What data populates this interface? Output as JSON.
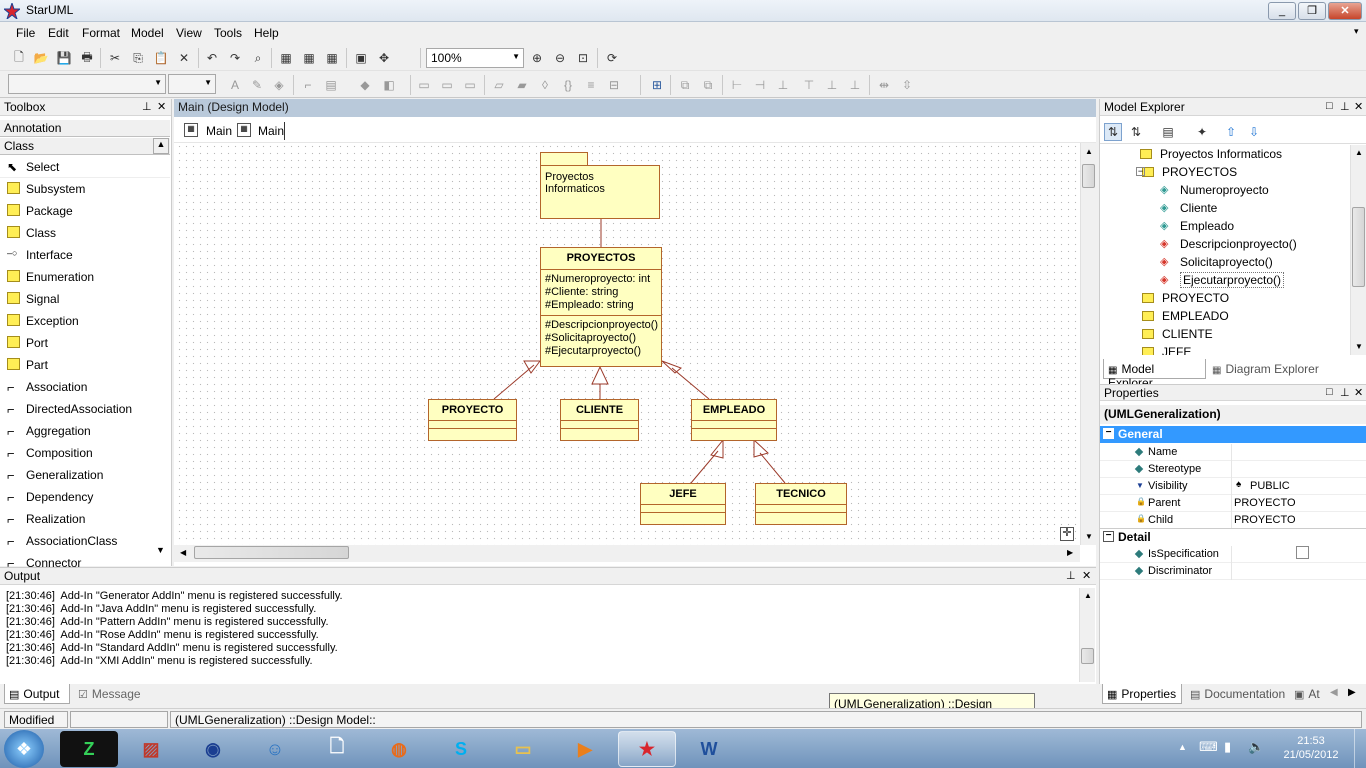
{
  "window": {
    "title": "StarUML",
    "min": "_",
    "max": "❐",
    "close": "✕"
  },
  "menu": [
    "File",
    "Edit",
    "Format",
    "Model",
    "View",
    "Tools",
    "Help"
  ],
  "toolbar": {
    "zoom": "100%"
  },
  "toolbox": {
    "title": "Toolbox",
    "annotation": "Annotation",
    "class_header": "Class",
    "items": [
      "Select",
      "Subsystem",
      "Package",
      "Class",
      "Interface",
      "Enumeration",
      "Signal",
      "Exception",
      "Port",
      "Part",
      "Association",
      "DirectedAssociation",
      "Aggregation",
      "Composition",
      "Generalization",
      "Dependency",
      "Realization",
      "AssociationClass",
      "Connector"
    ]
  },
  "diagram": {
    "title": "Main (Design Model)",
    "tabs": [
      "Main",
      "Main"
    ],
    "package_name": "Proyectos Informaticos",
    "main_class": {
      "name": "PROYECTOS",
      "attributes": [
        "#Numeroproyecto: int",
        "#Cliente: string",
        "#Empleado: string"
      ],
      "operations": [
        "#Descripcionproyecto()",
        "#Solicitaproyecto()",
        "#Ejecutarproyecto()"
      ]
    },
    "sub_classes": [
      "PROYECTO",
      "CLIENTE",
      "EMPLEADO"
    ],
    "leaf_classes": [
      "JEFE",
      "TECNICO"
    ]
  },
  "explorer": {
    "title": "Model Explorer",
    "items": [
      {
        "label": "Proyectos Informaticos",
        "type": "package"
      },
      {
        "label": "PROYECTOS",
        "type": "class"
      },
      {
        "label": "Numeroproyecto",
        "type": "attribute"
      },
      {
        "label": "Cliente",
        "type": "attribute"
      },
      {
        "label": "Empleado",
        "type": "attribute"
      },
      {
        "label": "Descripcionproyecto()",
        "type": "operation"
      },
      {
        "label": "Solicitaproyecto()",
        "type": "operation"
      },
      {
        "label": "Ejecutarproyecto()",
        "type": "operation"
      },
      {
        "label": "PROYECTO",
        "type": "class"
      },
      {
        "label": "EMPLEADO",
        "type": "class"
      },
      {
        "label": "CLIENTE",
        "type": "class"
      },
      {
        "label": "JEFE",
        "type": "class"
      }
    ],
    "tabs": [
      "Model Explorer",
      "Diagram Explorer"
    ]
  },
  "properties": {
    "title": "Properties",
    "selection": "(UMLGeneralization)",
    "group_general": "General",
    "group_detail": "Detail",
    "rows": [
      {
        "name": "Name",
        "value": ""
      },
      {
        "name": "Stereotype",
        "value": ""
      },
      {
        "name": "Visibility",
        "value": "PUBLIC"
      },
      {
        "name": "Parent",
        "value": "PROYECTO"
      },
      {
        "name": "Child",
        "value": "PROYECTO"
      }
    ],
    "detail_rows": [
      {
        "name": "IsSpecification",
        "value": ""
      },
      {
        "name": "Discriminator",
        "value": ""
      }
    ],
    "tabs": [
      "Properties",
      "Documentation",
      "At"
    ]
  },
  "output": {
    "title": "Output",
    "lines": [
      "[21:30:46]  Add-In \"Generator AddIn\" menu is registered successfully.",
      "[21:30:46]  Add-In \"Java AddIn\" menu is registered successfully.",
      "[21:30:46]  Add-In \"Pattern AddIn\" menu is registered successfully.",
      "[21:30:46]  Add-In \"Rose AddIn\" menu is registered successfully.",
      "[21:30:46]  Add-In \"Standard AddIn\" menu is registered successfully.",
      "[21:30:46]  Add-In \"XMI AddIn\" menu is registered successfully."
    ],
    "tabs": [
      "Output",
      "Message"
    ]
  },
  "status": {
    "modified": "Modified",
    "path": "(UMLGeneralization) ::Design Model::"
  },
  "tooltip": "(UMLGeneralization) ::Design Model::",
  "taskbar": {
    "time": "21:53",
    "date": "21/05/2012"
  }
}
